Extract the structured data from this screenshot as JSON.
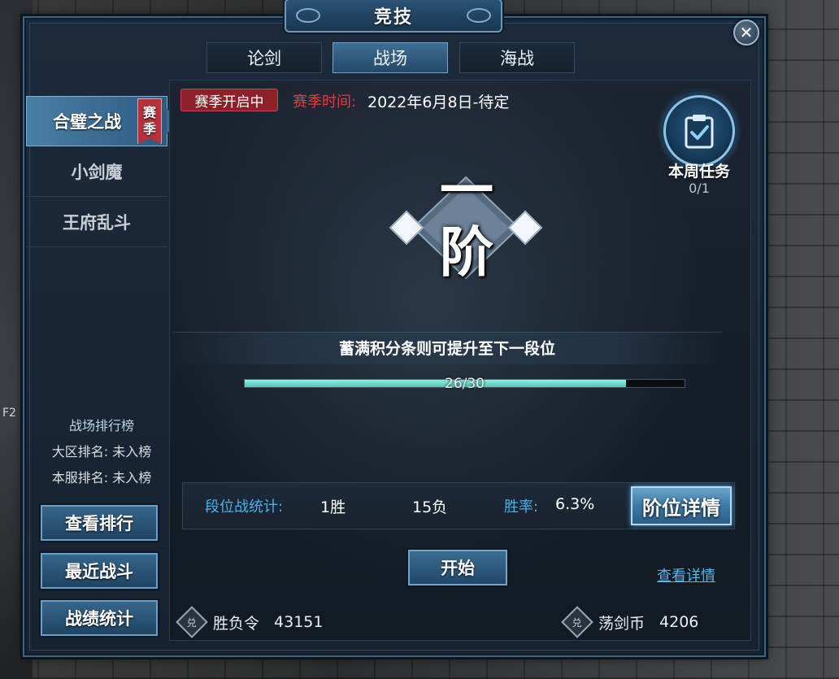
{
  "window": {
    "title": "竞技",
    "close": "✕"
  },
  "tabs": [
    {
      "label": "论剑",
      "active": false
    },
    {
      "label": "战场",
      "active": true
    },
    {
      "label": "海战",
      "active": false
    }
  ],
  "left_nav": {
    "items": [
      {
        "label": "合璧之战",
        "active": true,
        "ribbon": [
          "赛",
          "季"
        ]
      },
      {
        "label": "小剑魔",
        "active": false
      },
      {
        "label": "王府乱斗",
        "active": false
      }
    ]
  },
  "ranking": {
    "title": "战场排行榜",
    "region_label": "大区排名: 未入榜",
    "server_label": "本服排名: 未入榜"
  },
  "side_buttons": {
    "view_rank": "查看排行",
    "recent_battles": "最近战斗",
    "battle_stats": "战绩统计"
  },
  "season": {
    "status": "赛季开启中",
    "time_label": "赛季时间:",
    "time_value": "2022年6月8日-待定"
  },
  "weekly_task": {
    "label": "本周任务",
    "progress": "0/1"
  },
  "rank": {
    "glyph_top": "一",
    "glyph_bottom": "阶"
  },
  "progress": {
    "hint": "蓄满积分条则可提升至下一段位",
    "text": "26/30",
    "current": 26,
    "max": 30
  },
  "stats": {
    "label": "段位战统计:",
    "wins": "1胜",
    "losses": "15负",
    "winrate_label": "胜率:",
    "winrate_value": "6.3%",
    "detail_button": "阶位详情"
  },
  "actions": {
    "start": "开始",
    "view_details": "查看详情"
  },
  "currencies": [
    {
      "icon_glyph": "兑",
      "name": "胜负令",
      "value": "43151"
    },
    {
      "icon_glyph": "兑",
      "name": "荡剑币",
      "value": "4206"
    }
  ],
  "background": {
    "hotkey_label": "F2"
  },
  "colors": {
    "accent": "#3f6f93",
    "progress": "#4ec8b6",
    "season_badge": "#8f1f28",
    "season_time_label": "#e83a3a",
    "stat_label": "#4ab0e8",
    "link": "#57b6e8"
  }
}
